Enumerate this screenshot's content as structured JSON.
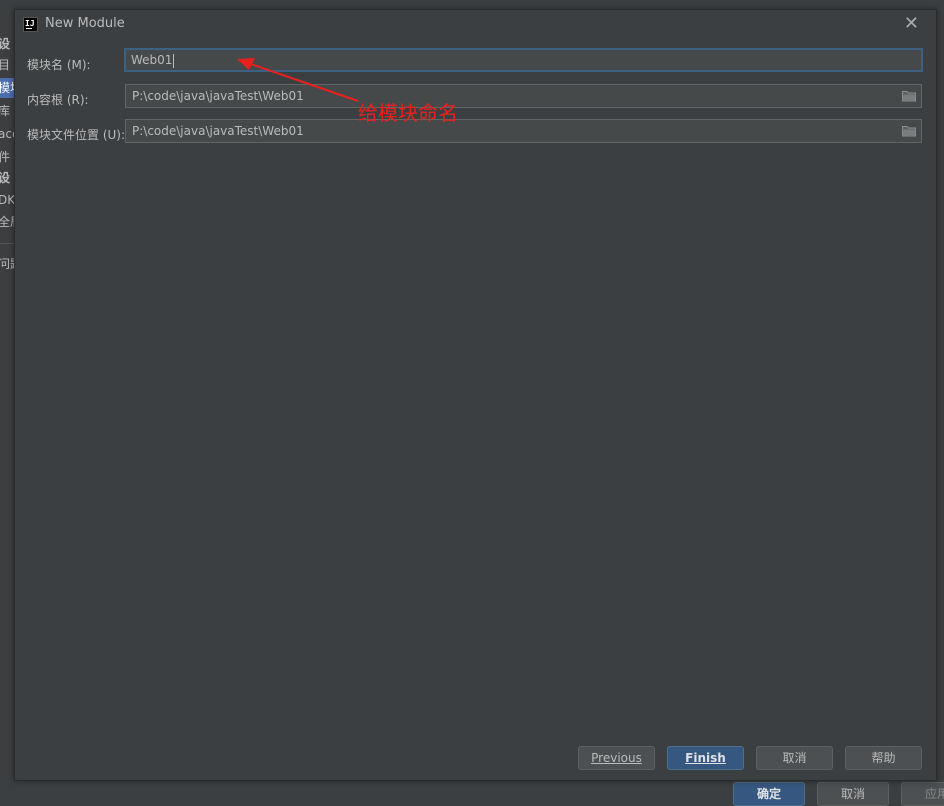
{
  "background": {
    "left_items": [
      "设",
      "目",
      "模块",
      "库",
      "acet",
      "件",
      "设",
      "DK",
      "全局",
      "问题"
    ],
    "buttons": {
      "ok": "确定",
      "cancel": "取消",
      "apply": "应用"
    }
  },
  "dialog": {
    "title": "New Module",
    "fields": {
      "module_name": {
        "label": "模块名 (M):",
        "value": "Web01"
      },
      "content_root": {
        "label": "内容根 (R):",
        "value": "P:\\code\\java\\javaTest\\Web01"
      },
      "module_file": {
        "label": "模块文件位置 (U):",
        "value": "P:\\code\\java\\javaTest\\Web01"
      }
    },
    "annotation": "给模块命名",
    "buttons": {
      "previous": "Previous",
      "finish": "Finish",
      "cancel": "取消",
      "help": "帮助"
    }
  },
  "colors": {
    "background": "#3c3f41",
    "field_bg": "#45494a",
    "focus_border": "#3d6185",
    "primary_button": "#365880",
    "annotation": "#e8211f"
  },
  "icons": [
    "intellij-app-icon",
    "close-icon",
    "folder-icon",
    "annotation-arrow"
  ]
}
